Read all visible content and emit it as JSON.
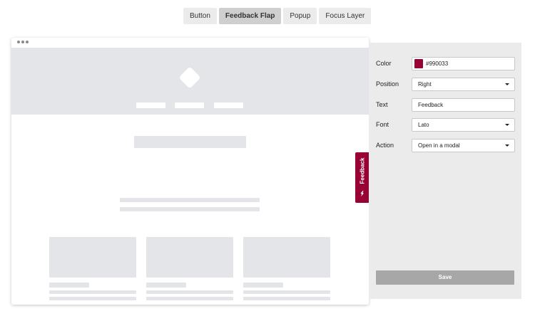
{
  "tabs": [
    {
      "label": "Button",
      "active": false
    },
    {
      "label": "Feedback Flap",
      "active": true
    },
    {
      "label": "Popup",
      "active": false
    },
    {
      "label": "Focus Layer",
      "active": false
    }
  ],
  "settings": {
    "color_label": "Color",
    "color_value": "#990033",
    "position_label": "Position",
    "position_value": "Right",
    "text_label": "Text",
    "text_value": "Feedback",
    "font_label": "Font",
    "font_value": "Lato",
    "action_label": "Action",
    "action_value": "Open in a modal",
    "save_label": "Save"
  },
  "flap": {
    "text": "Feedback",
    "icon": "feedback-logo-icon",
    "color": "#990033"
  },
  "colors": {
    "placeholder": "#e3e5e9",
    "panel": "#ebebeb",
    "save_button": "#a7a7a7"
  }
}
